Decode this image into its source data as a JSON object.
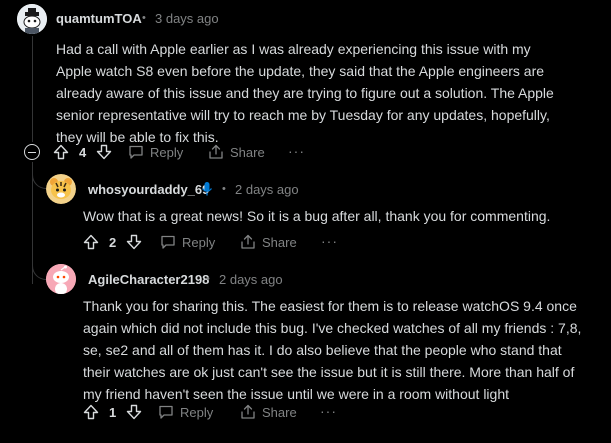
{
  "comments": [
    {
      "username": "quamtumTOA",
      "separator": "•",
      "time": "3 days ago",
      "body": "Had a call with Apple earlier as I was already experiencing this issue with my Apple watch S8 even before the update, they said that the Apple engineers are already aware of this issue and they are trying to figure out a solution. The Apple senior representative will try to reach me by Tuesday for any updates, hopefully, they will be able to fix this.",
      "votes": "4",
      "reply_label": "Reply",
      "share_label": "Share",
      "more_label": "···",
      "avatar_icon": "snoo-avatar-icon"
    },
    {
      "username": "whosyourdaddy_69",
      "separator": "•",
      "time": "2 days ago",
      "body": "Wow that is a great news! So it is a bug after all, thank you for commenting.",
      "votes": "2",
      "reply_label": "Reply",
      "share_label": "Share",
      "more_label": "···",
      "avatar_icon": "tiger-avatar-icon",
      "badge_icon": "microphone-icon"
    },
    {
      "username": "AgileCharacter2198",
      "separator": "•",
      "time": "2 days ago",
      "body": "Thank you for sharing this. The easiest for them is to release watchOS 9.4 once again which did not include this bug. I've checked watches of all my friends : 7,8, se, se2 and all of them has it. I do also believe that the people who stand that their watches are ok just can't see the issue but it is still there. More than half of my friend haven't seen the issue until we were in a room without light",
      "votes": "1",
      "reply_label": "Reply",
      "share_label": "Share",
      "more_label": "···",
      "avatar_icon": "snoo-pink-avatar-icon"
    }
  ],
  "colors": {
    "background": "#000000",
    "text": "#d7dadc",
    "muted": "#818384",
    "thread_line": "#343536",
    "badge_blue": "#0079d3"
  }
}
